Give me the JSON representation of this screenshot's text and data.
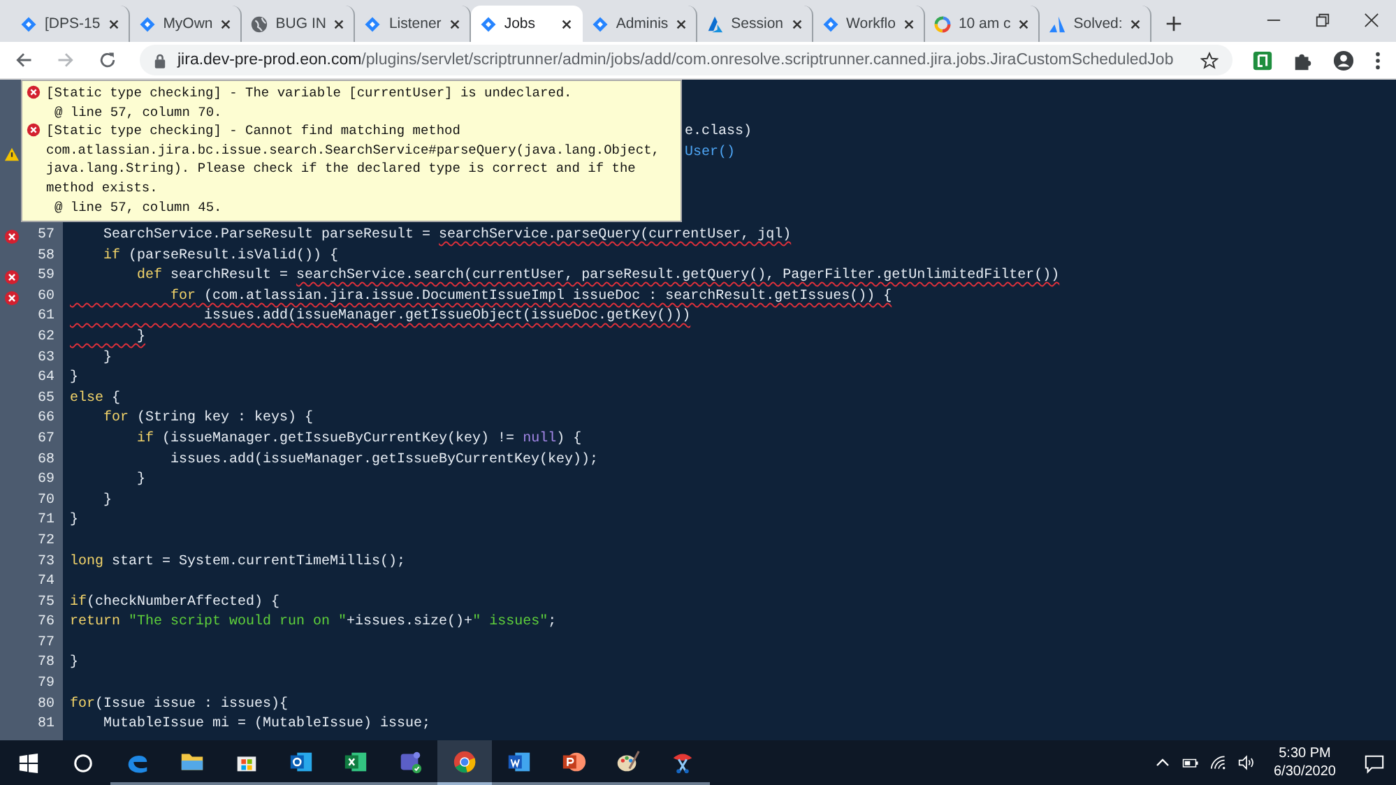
{
  "browser": {
    "tabs": [
      {
        "title": "[DPS-15",
        "kind": "diamond",
        "selected": false
      },
      {
        "title": "MyOwn",
        "kind": "diamond",
        "selected": false
      },
      {
        "title": "BUG IN",
        "kind": "globe",
        "selected": false
      },
      {
        "title": "Listener",
        "kind": "diamond",
        "selected": false
      },
      {
        "title": "Jobs",
        "kind": "diamond",
        "selected": true
      },
      {
        "title": "Adminis",
        "kind": "diamond",
        "selected": false
      },
      {
        "title": "Session",
        "kind": "azure",
        "selected": false
      },
      {
        "title": "Workflo",
        "kind": "diamond",
        "selected": false
      },
      {
        "title": "10 am c",
        "kind": "google",
        "selected": false
      },
      {
        "title": "Solved:",
        "kind": "peaks",
        "selected": false
      }
    ],
    "address": {
      "host": "jira.dev-pre-prod.eon.com",
      "path": "/plugins/servlet/scriptrunner/admin/jobs/add/com.onresolve.scriptrunner.canned.jira.jobs.JiraCustomScheduledJob"
    }
  },
  "editor": {
    "tooltip": [
      {
        "kind": "error",
        "text": "[Static type checking] - The variable [currentUser] is undeclared.",
        "location": "@ line 57, column 70."
      },
      {
        "kind": "error",
        "text": "[Static type checking] - Cannot find matching method com.atlassian.jira.bc.issue.search.SearchService#parseQuery(java.lang.Object, java.lang.String). Please check if the declared type is correct and if the method exists.",
        "location": "@ line 57, column 45."
      }
    ],
    "covered_lines": [
      {
        "kind": "plain",
        "tokens": [
          {
            "kind": "plain",
            "text": "e.class)",
            "squiggle": false
          }
        ]
      },
      {
        "kind": "warning",
        "tokens": [
          {
            "kind": "call",
            "text": "User()",
            "squiggle": false
          }
        ]
      }
    ],
    "lines": [
      {
        "n": "57",
        "kind": "error",
        "tokens": [
          {
            "kind": "plain",
            "text": "    SearchService.ParseResult parseResult = ",
            "squiggle": false
          },
          {
            "kind": "plain",
            "text": "searchService.parseQuery(currentUser, jql)",
            "squiggle": true
          }
        ]
      },
      {
        "n": "58",
        "kind": "plain",
        "tokens": [
          {
            "kind": "keyword",
            "text": "    if",
            "squiggle": false
          },
          {
            "kind": "plain",
            "text": " (parseResult.isValid()) {",
            "squiggle": false
          }
        ]
      },
      {
        "n": "59",
        "kind": "error",
        "tokens": [
          {
            "kind": "keyword",
            "text": "        def",
            "squiggle": false
          },
          {
            "kind": "plain",
            "text": " searchResult = ",
            "squiggle": false
          },
          {
            "kind": "plain",
            "text": "searchService.search(currentUser, parseResult.getQuery(), PagerFilter.getUnlimitedFilter())",
            "squiggle": true
          }
        ]
      },
      {
        "n": "60",
        "kind": "error",
        "tokens": [
          {
            "kind": "keyword",
            "text": "            for",
            "squiggle": true
          },
          {
            "kind": "plain",
            "text": " (com.atlassian.jira.issue.DocumentIssueImpl issueDoc : searchResult.getIssues()) {",
            "squiggle": true
          }
        ]
      },
      {
        "n": "61",
        "kind": "plain",
        "tokens": [
          {
            "kind": "plain",
            "text": "                issues.add(issueManager.getIssueObject(issueDoc.getKey()))",
            "squiggle": true
          }
        ]
      },
      {
        "n": "62",
        "kind": "plain",
        "tokens": [
          {
            "kind": "plain",
            "text": "        }",
            "squiggle": true
          }
        ]
      },
      {
        "n": "63",
        "kind": "plain",
        "tokens": [
          {
            "kind": "plain",
            "text": "    }",
            "squiggle": false
          }
        ]
      },
      {
        "n": "64",
        "kind": "plain",
        "tokens": [
          {
            "kind": "plain",
            "text": "}",
            "squiggle": false
          }
        ]
      },
      {
        "n": "65",
        "kind": "plain",
        "tokens": [
          {
            "kind": "keyword",
            "text": "else",
            "squiggle": false
          },
          {
            "kind": "plain",
            "text": " {",
            "squiggle": false
          }
        ]
      },
      {
        "n": "66",
        "kind": "plain",
        "tokens": [
          {
            "kind": "keyword",
            "text": "    for",
            "squiggle": false
          },
          {
            "kind": "plain",
            "text": " (String key : keys) {",
            "squiggle": false
          }
        ]
      },
      {
        "n": "67",
        "kind": "plain",
        "tokens": [
          {
            "kind": "keyword",
            "text": "        if",
            "squiggle": false
          },
          {
            "kind": "plain",
            "text": " (issueManager.getIssueByCurrentKey(key) != ",
            "squiggle": false
          },
          {
            "kind": "literal",
            "text": "null",
            "squiggle": false
          },
          {
            "kind": "plain",
            "text": ") {",
            "squiggle": false
          }
        ]
      },
      {
        "n": "68",
        "kind": "plain",
        "tokens": [
          {
            "kind": "plain",
            "text": "            issues.add(issueManager.getIssueByCurrentKey(key));",
            "squiggle": false
          }
        ]
      },
      {
        "n": "69",
        "kind": "plain",
        "tokens": [
          {
            "kind": "plain",
            "text": "        }",
            "squiggle": false
          }
        ]
      },
      {
        "n": "70",
        "kind": "plain",
        "tokens": [
          {
            "kind": "plain",
            "text": "    }",
            "squiggle": false
          }
        ]
      },
      {
        "n": "71",
        "kind": "plain",
        "tokens": [
          {
            "kind": "plain",
            "text": "}",
            "squiggle": false
          }
        ]
      },
      {
        "n": "72",
        "kind": "plain"
      },
      {
        "n": "73",
        "kind": "plain",
        "tokens": [
          {
            "kind": "keyword",
            "text": "long",
            "squiggle": false
          },
          {
            "kind": "plain",
            "text": " start = System.currentTimeMillis();",
            "squiggle": false
          }
        ]
      },
      {
        "n": "74",
        "kind": "plain"
      },
      {
        "n": "75",
        "kind": "plain",
        "tokens": [
          {
            "kind": "keyword",
            "text": "if",
            "squiggle": false
          },
          {
            "kind": "plain",
            "text": "(checkNumberAffected) {",
            "squiggle": false
          }
        ]
      },
      {
        "n": "76",
        "kind": "plain",
        "tokens": [
          {
            "kind": "keyword",
            "text": "return",
            "squiggle": false
          },
          {
            "kind": "string",
            "text": " \"The script would run on \"",
            "squiggle": false
          },
          {
            "kind": "plain",
            "text": "+issues.size()+",
            "squiggle": false
          },
          {
            "kind": "string",
            "text": "\" issues\"",
            "squiggle": false
          },
          {
            "kind": "plain",
            "text": ";",
            "squiggle": false
          }
        ]
      },
      {
        "n": "77",
        "kind": "plain"
      },
      {
        "n": "78",
        "kind": "plain",
        "tokens": [
          {
            "kind": "plain",
            "text": "}",
            "squiggle": false
          }
        ]
      },
      {
        "n": "79",
        "kind": "plain"
      },
      {
        "n": "80",
        "kind": "plain",
        "tokens": [
          {
            "kind": "keyword",
            "text": "for",
            "squiggle": false
          },
          {
            "kind": "plain",
            "text": "(Issue issue : issues){",
            "squiggle": false
          }
        ]
      },
      {
        "n": "81",
        "kind": "plain",
        "tokens": [
          {
            "kind": "plain",
            "text": "    MutableIssue mi = (MutableIssue) issue;",
            "squiggle": false
          }
        ]
      }
    ]
  },
  "taskbar": {
    "apps": [
      {
        "kind": "edge",
        "active": false
      },
      {
        "kind": "folder",
        "active": false
      },
      {
        "kind": "store",
        "active": false
      },
      {
        "kind": "mail",
        "active": false
      },
      {
        "kind": "sheet",
        "active": false
      },
      {
        "kind": "chat",
        "active": false
      },
      {
        "kind": "chrome",
        "active": true
      },
      {
        "kind": "doc",
        "active": false
      },
      {
        "kind": "slides",
        "active": false
      },
      {
        "kind": "paint",
        "active": false
      },
      {
        "kind": "snip",
        "active": false
      }
    ],
    "time": "5:30 PM",
    "date": "6/30/2020"
  }
}
